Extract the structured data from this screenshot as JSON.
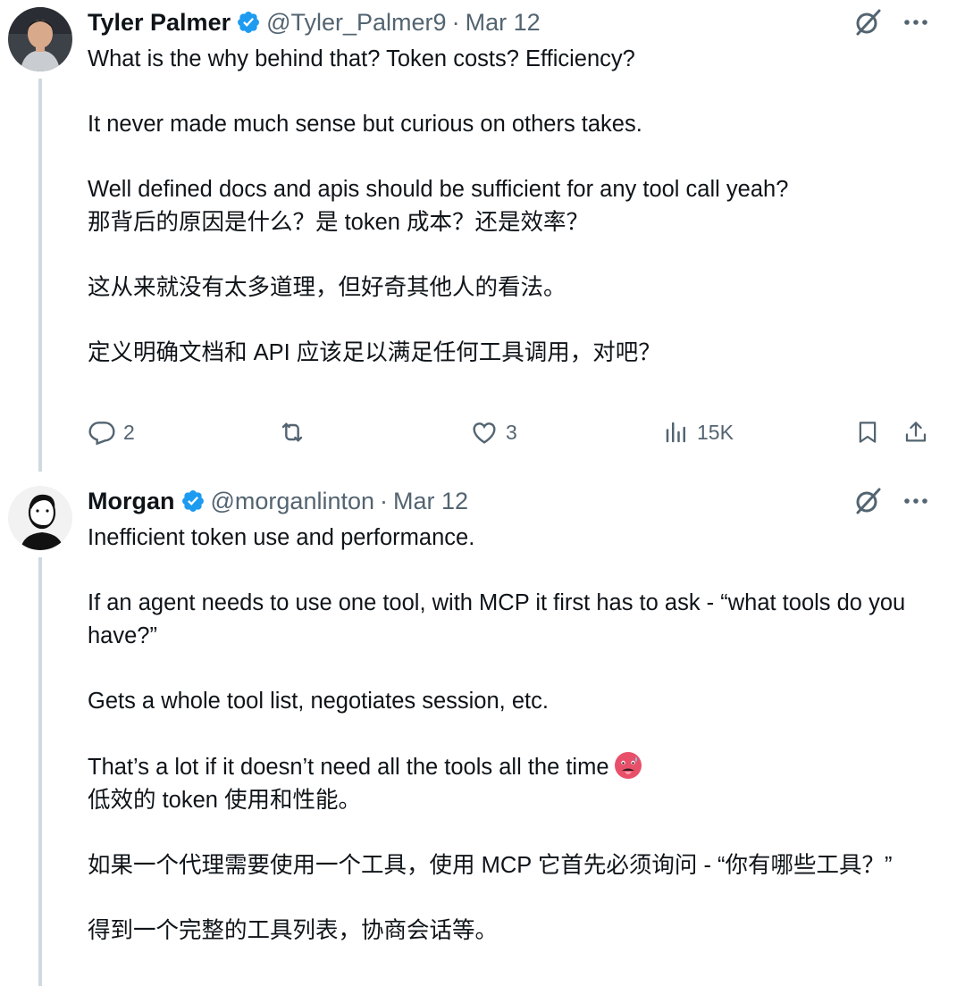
{
  "tweets": [
    {
      "display_name": "Tyler Palmer",
      "handle": "@Tyler_Palmer9",
      "separator": "·",
      "date": "Mar 12",
      "paragraphs": [
        "What is the why behind that? Token costs? Efficiency?",
        "It never made much sense but curious on others takes.",
        "Well defined docs and apis should be sufficient for any tool call yeah?",
        "那背后的原因是什么？是 token 成本？还是效率？",
        "这从来就没有太多道理，但好奇其他人的看法。",
        "定义明确文档和 API 应该足以满足任何工具调用，对吧？"
      ],
      "actions": {
        "replies": "2",
        "retweets": "",
        "likes": "3",
        "views": "15K"
      }
    },
    {
      "display_name": "Morgan",
      "handle": "@morganlinton",
      "separator": "·",
      "date": "Mar 12",
      "paragraphs": [
        "Inefficient token use and performance.",
        "If an agent needs to use one tool, with MCP it first has to ask - “what tools do you have?”",
        "Gets a whole tool list, negotiates session, etc.",
        "That’s a lot if it doesn’t need all the tools all the time",
        "低效的 token 使用和性能。",
        "如果一个代理需要使用一个工具，使用 MCP 它首先必须询问 - “你有哪些工具？”",
        "得到一个完整的工具列表，协商会话等。"
      ]
    }
  ],
  "icons": {
    "verified": "verified-badge-icon",
    "grok": "grok-icon",
    "more": "more-icon",
    "reply": "reply-icon",
    "retweet": "retweet-icon",
    "like": "like-icon",
    "views": "views-icon",
    "bookmark": "bookmark-icon",
    "share": "share-icon",
    "emoji": "hot-face-emoji"
  },
  "colors": {
    "text": "#0f1419",
    "secondary": "#536471",
    "verified": "#1d9bf0",
    "thread_line": "#cfd9de"
  }
}
